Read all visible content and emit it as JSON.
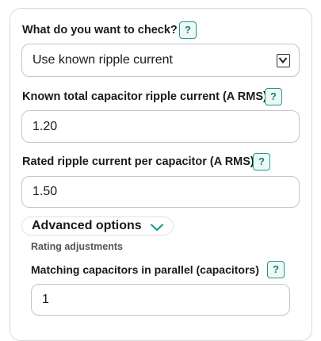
{
  "check_mode": {
    "label": "What do you want to check?",
    "help": "?",
    "selected": "Use known ripple current"
  },
  "known_ripple": {
    "label": "Known total capacitor ripple current (A RMS)",
    "help": "?",
    "value": "1.20"
  },
  "rated_ripple": {
    "label": "Rated ripple current per capacitor (A RMS)",
    "help": "?",
    "value": "1.50"
  },
  "advanced": {
    "label": "Advanced options",
    "icon": "chevron-down-icon",
    "accent": "#1a9a8a",
    "section_title": "Rating adjustments",
    "parallel": {
      "label": "Matching capacitors in parallel (capacitors)",
      "help": "?",
      "value": "1"
    }
  }
}
